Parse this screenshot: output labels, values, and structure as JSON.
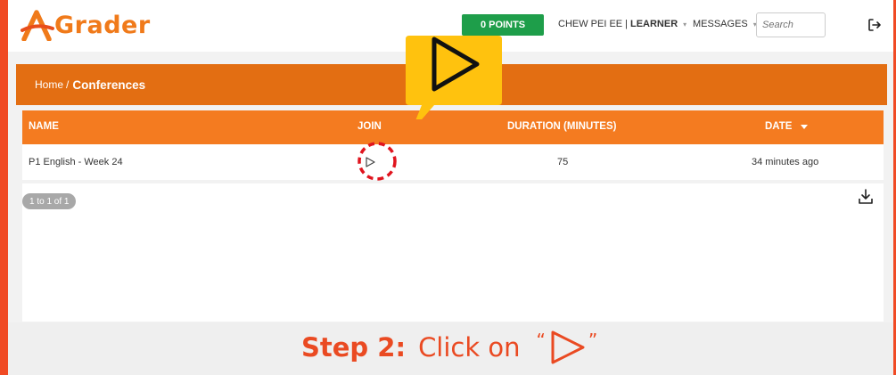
{
  "app": {
    "logo_text": "Grader",
    "brand_color": "#f07a1a",
    "accent_color": "#f47b20"
  },
  "header": {
    "points_label": "0 POINTS",
    "user_name": "CHEW PEI EE",
    "user_separator": "|",
    "user_role": "LEARNER",
    "messages_label": "MESSAGES",
    "search_placeholder": "Search",
    "logout_icon": "logout-icon"
  },
  "breadcrumb": {
    "home": "Home",
    "separator": "/",
    "current": "Conferences"
  },
  "table": {
    "columns": {
      "name": "NAME",
      "join": "JOIN",
      "duration": "DURATION (MINUTES)",
      "date": "DATE"
    },
    "rows": [
      {
        "name": "P1 English - Week 24",
        "join_icon": "play-icon",
        "duration": "75",
        "date": "34 minutes ago"
      }
    ],
    "pagination": "1 to 1 of 1",
    "download_icon": "download-icon"
  },
  "tutorial": {
    "step_label": "Step 2:",
    "step_text": "Click on",
    "open_quote": "“",
    "close_quote": "”",
    "caption_color": "#ea4a22",
    "callout_color": "#ffc20e"
  }
}
